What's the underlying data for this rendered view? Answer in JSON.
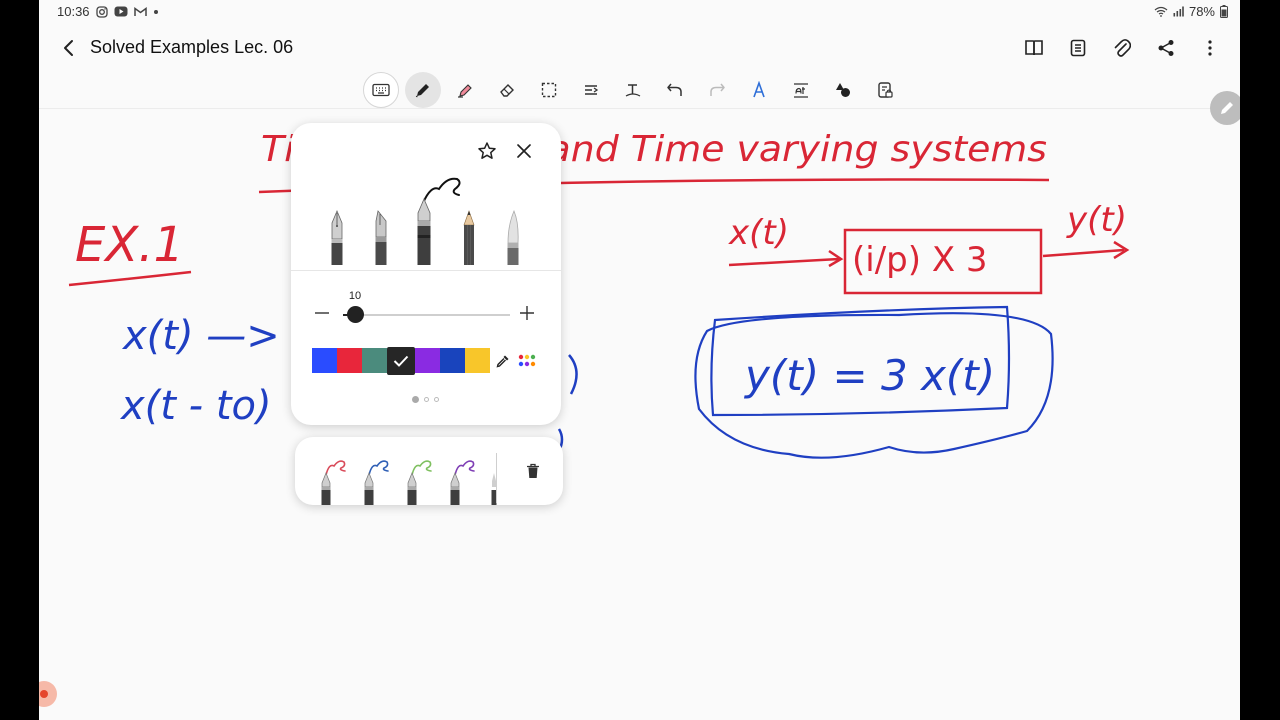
{
  "status_bar": {
    "time": "10:36",
    "battery": "78%"
  },
  "header": {
    "title": "Solved Examples Lec. 06",
    "actions": [
      "book-view-icon",
      "page-list-icon",
      "attach-icon",
      "share-icon",
      "more-icon"
    ]
  },
  "toolbar": {
    "tools": [
      "keyboard-icon",
      "pen-icon",
      "highlighter-icon",
      "eraser-icon",
      "lasso-select-icon",
      "shape-icon",
      "text-icon",
      "undo-icon",
      "redo-icon",
      "ink-to-text-icon",
      "text-convert-icon",
      "insert-shapes-icon",
      "read-only-icon"
    ],
    "selected": "pen-icon"
  },
  "pen_popup": {
    "pen_types": [
      "fountain-pen",
      "calligraphy-pen",
      "fineliner-pen",
      "pencil",
      "brush-pen"
    ],
    "selected_pen": "fineliner-pen",
    "size": {
      "value": "10",
      "fraction": 0.06
    },
    "colors": [
      "#2a4cff",
      "#e8263b",
      "#4b8b7d",
      "#262626",
      "#8a2be2",
      "#1944bd",
      "#f8c62a"
    ],
    "selected_color": "#262626",
    "page_count": 3,
    "active_page": 0
  },
  "favorites": {
    "pens": [
      {
        "color": "#d94b5a"
      },
      {
        "color": "#2f5fb5"
      },
      {
        "color": "#7fc060"
      },
      {
        "color": "#7f3fb5"
      }
    ]
  },
  "canvas": {
    "title_text": "Time Invariant and Time varying systems",
    "title_color": "#d92635",
    "ink_color": "#1f3fc2",
    "example_label": "EX.1",
    "line1": "x(t) —> t",
    "line2": "x(t - to)",
    "input_label": "x(t)",
    "block_label": "(i/p) X 3",
    "output_label": "y(t)",
    "equation": "y(t) = 3 x(t)"
  }
}
